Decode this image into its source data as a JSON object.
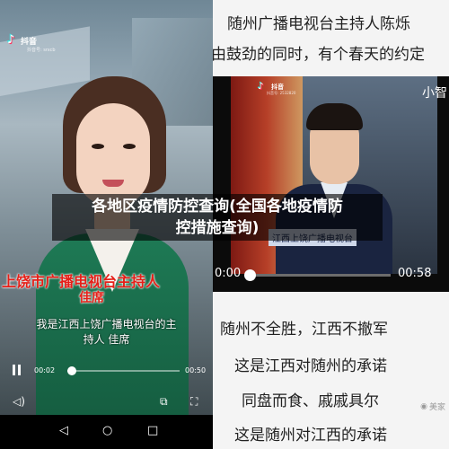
{
  "overlay": {
    "title_line1": "各地区疫情防控查询(全国各地疫情防",
    "title_line2": "控措施查询)"
  },
  "left_video": {
    "app_name": "抖音",
    "app_id": "抖音号: srxcb",
    "caption_line1": "上饶市广播电视台主持人",
    "caption_line2": "佳席",
    "subtitle_line1": "我是江西上饶广播电视台的主",
    "subtitle_line2": "持人 佳席",
    "current_time": "00:02",
    "total_time": "00:50",
    "progress": 0.04
  },
  "nav_icons": [
    "back-icon",
    "home-icon",
    "recents-icon"
  ],
  "right_panel": {
    "top_line1": "随州广播电视台主持人陈烁",
    "top_line2": "由鼓劲的同时，有个春天的约定",
    "video": {
      "app_name": "抖音",
      "app_id": "抖音号: 2532820",
      "side_text": "小智",
      "caption": "江西上饶广播电视台",
      "current_time": "0:00",
      "total_time": "00:58",
      "progress": 0.02
    },
    "lines": [
      "随州不全胜，江西不撤军",
      "这是江西对随州的承诺",
      "同盘而食、戚戚具尔",
      "这是随州对江西的承诺"
    ],
    "watermark": "美家"
  }
}
